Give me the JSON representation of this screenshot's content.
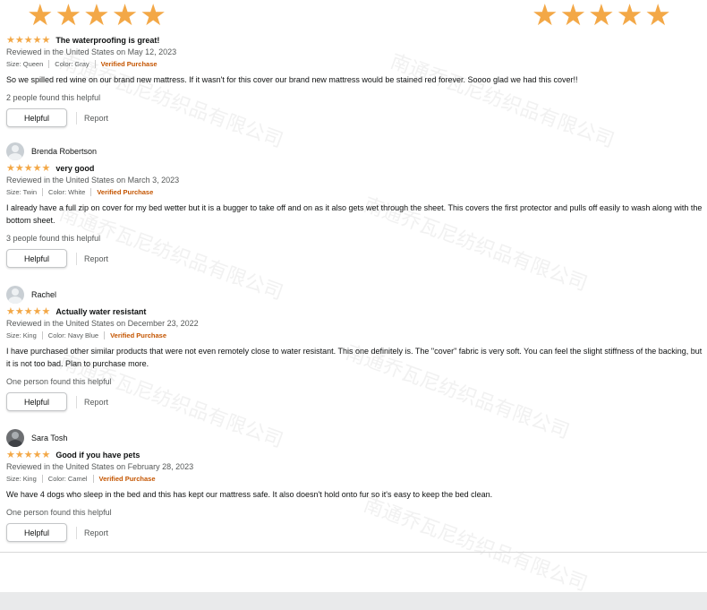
{
  "top_stars": {
    "left": "★★★★★",
    "right": "★★★★★",
    "color": "#f3a847"
  },
  "watermark": "南通乔瓦尼纺织品有限公司",
  "reviews": [
    {
      "reviewer": "",
      "rating_stars": "★★★★★",
      "rating": 5,
      "title": "The waterproofing is great!",
      "reviewed": "Reviewed in the United States on May 12, 2023",
      "size": "Size: Queen",
      "color": "Color: Gray",
      "verified": "Verified Purchase",
      "body": "So we spilled red wine on our brand new mattress. If it wasn't for this cover our brand new mattress would be stained red forever. Soooo glad we had this cover!!",
      "found_helpful": "2 people found this helpful",
      "helpful_label": "Helpful",
      "report_label": "Report"
    },
    {
      "reviewer": "Brenda Robertson",
      "rating_stars": "★★★★★",
      "rating": 5,
      "title": "very good",
      "reviewed": "Reviewed in the United States on March 3, 2023",
      "size": "Size: Twin",
      "color": "Color: White",
      "verified": "Verified Purchase",
      "body": "I already have a full zip on cover for my bed wetter but it is a bugger to take off and on as it also gets wet through the sheet. This covers the first protector and pulls off easily to wash along with the bottom sheet.",
      "found_helpful": "3 people found this helpful",
      "helpful_label": "Helpful",
      "report_label": "Report"
    },
    {
      "reviewer": "Rachel",
      "rating_stars": "★★★★★",
      "rating": 5,
      "title": "Actually water resistant",
      "reviewed": "Reviewed in the United States on December 23, 2022",
      "size": "Size: King",
      "color": "Color: Navy Blue",
      "verified": "Verified Purchase",
      "body": "I have purchased other similar products that were not even remotely close to water resistant. This one definitely is. The \"cover\" fabric is very soft. You can feel the slight stiffness of the backing, but it is not too bad. Plan to purchase more.",
      "found_helpful": "One person found this helpful",
      "helpful_label": "Helpful",
      "report_label": "Report"
    },
    {
      "reviewer": "Sara Tosh",
      "rating_stars": "★★★★★",
      "rating": 5,
      "title": "Good if you have pets",
      "reviewed": "Reviewed in the United States on February 28, 2023",
      "size": "Size: King",
      "color": "Color: Camel",
      "verified": "Verified Purchase",
      "body": "We have 4 dogs who sleep in the bed and this has kept our mattress safe. It also doesn't hold onto fur so it's easy to keep the bed clean.",
      "found_helpful": "One person found this helpful",
      "helpful_label": "Helpful",
      "report_label": "Report"
    }
  ]
}
